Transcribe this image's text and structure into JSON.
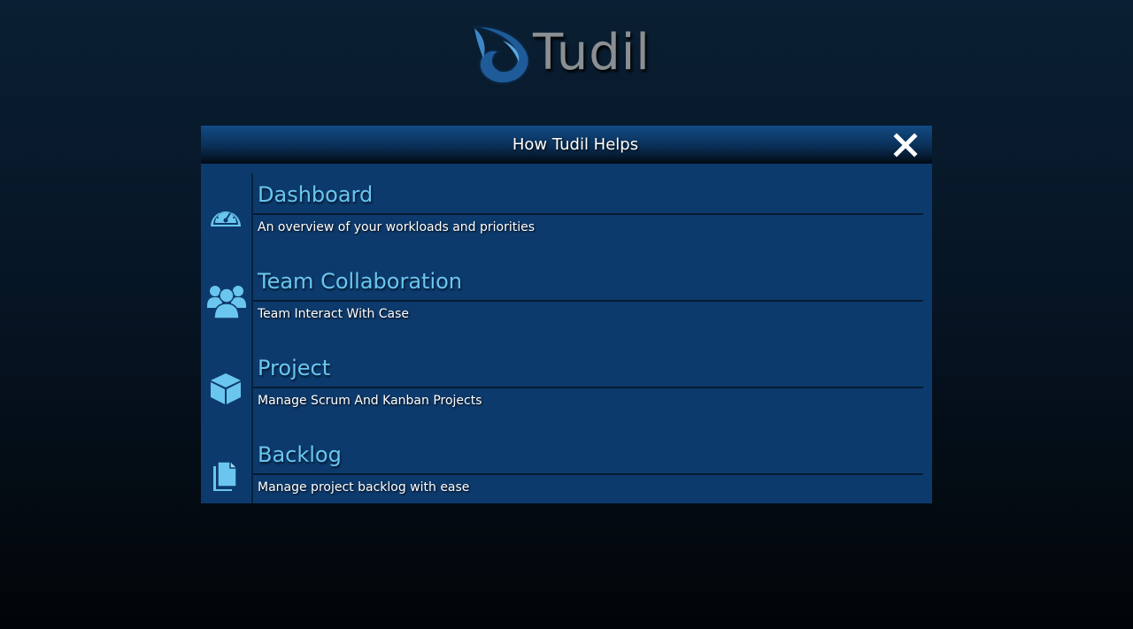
{
  "brand": {
    "name": "Tudil",
    "logo_icon": "tudil-logo-icon",
    "text_color": "#8a8f94"
  },
  "dialog": {
    "title": "How Tudil Helps",
    "close_icon": "close-icon",
    "background_color": "#0d3a6c",
    "accent_color": "#6ac6ee"
  },
  "features": [
    {
      "icon": "speedometer-icon",
      "title": "Dashboard",
      "description": "An overview of your workloads and priorities"
    },
    {
      "icon": "users-icon",
      "title": "Team Collaboration",
      "description": "Team Interact With Case"
    },
    {
      "icon": "cube-icon",
      "title": "Project",
      "description": "Manage Scrum And Kanban Projects"
    },
    {
      "icon": "documents-icon",
      "title": "Backlog",
      "description": "Manage project backlog with ease"
    }
  ]
}
